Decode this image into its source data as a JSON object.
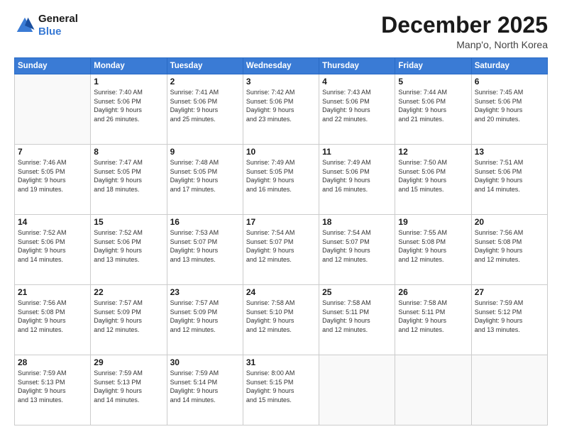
{
  "logo": {
    "line1": "General",
    "line2": "Blue"
  },
  "header": {
    "month": "December 2025",
    "location": "Manp'o, North Korea"
  },
  "weekdays": [
    "Sunday",
    "Monday",
    "Tuesday",
    "Wednesday",
    "Thursday",
    "Friday",
    "Saturday"
  ],
  "weeks": [
    [
      {
        "day": "",
        "info": ""
      },
      {
        "day": "1",
        "info": "Sunrise: 7:40 AM\nSunset: 5:06 PM\nDaylight: 9 hours\nand 26 minutes."
      },
      {
        "day": "2",
        "info": "Sunrise: 7:41 AM\nSunset: 5:06 PM\nDaylight: 9 hours\nand 25 minutes."
      },
      {
        "day": "3",
        "info": "Sunrise: 7:42 AM\nSunset: 5:06 PM\nDaylight: 9 hours\nand 23 minutes."
      },
      {
        "day": "4",
        "info": "Sunrise: 7:43 AM\nSunset: 5:06 PM\nDaylight: 9 hours\nand 22 minutes."
      },
      {
        "day": "5",
        "info": "Sunrise: 7:44 AM\nSunset: 5:06 PM\nDaylight: 9 hours\nand 21 minutes."
      },
      {
        "day": "6",
        "info": "Sunrise: 7:45 AM\nSunset: 5:06 PM\nDaylight: 9 hours\nand 20 minutes."
      }
    ],
    [
      {
        "day": "7",
        "info": "Sunrise: 7:46 AM\nSunset: 5:05 PM\nDaylight: 9 hours\nand 19 minutes."
      },
      {
        "day": "8",
        "info": "Sunrise: 7:47 AM\nSunset: 5:05 PM\nDaylight: 9 hours\nand 18 minutes."
      },
      {
        "day": "9",
        "info": "Sunrise: 7:48 AM\nSunset: 5:05 PM\nDaylight: 9 hours\nand 17 minutes."
      },
      {
        "day": "10",
        "info": "Sunrise: 7:49 AM\nSunset: 5:05 PM\nDaylight: 9 hours\nand 16 minutes."
      },
      {
        "day": "11",
        "info": "Sunrise: 7:49 AM\nSunset: 5:06 PM\nDaylight: 9 hours\nand 16 minutes."
      },
      {
        "day": "12",
        "info": "Sunrise: 7:50 AM\nSunset: 5:06 PM\nDaylight: 9 hours\nand 15 minutes."
      },
      {
        "day": "13",
        "info": "Sunrise: 7:51 AM\nSunset: 5:06 PM\nDaylight: 9 hours\nand 14 minutes."
      }
    ],
    [
      {
        "day": "14",
        "info": "Sunrise: 7:52 AM\nSunset: 5:06 PM\nDaylight: 9 hours\nand 14 minutes."
      },
      {
        "day": "15",
        "info": "Sunrise: 7:52 AM\nSunset: 5:06 PM\nDaylight: 9 hours\nand 13 minutes."
      },
      {
        "day": "16",
        "info": "Sunrise: 7:53 AM\nSunset: 5:07 PM\nDaylight: 9 hours\nand 13 minutes."
      },
      {
        "day": "17",
        "info": "Sunrise: 7:54 AM\nSunset: 5:07 PM\nDaylight: 9 hours\nand 12 minutes."
      },
      {
        "day": "18",
        "info": "Sunrise: 7:54 AM\nSunset: 5:07 PM\nDaylight: 9 hours\nand 12 minutes."
      },
      {
        "day": "19",
        "info": "Sunrise: 7:55 AM\nSunset: 5:08 PM\nDaylight: 9 hours\nand 12 minutes."
      },
      {
        "day": "20",
        "info": "Sunrise: 7:56 AM\nSunset: 5:08 PM\nDaylight: 9 hours\nand 12 minutes."
      }
    ],
    [
      {
        "day": "21",
        "info": "Sunrise: 7:56 AM\nSunset: 5:08 PM\nDaylight: 9 hours\nand 12 minutes."
      },
      {
        "day": "22",
        "info": "Sunrise: 7:57 AM\nSunset: 5:09 PM\nDaylight: 9 hours\nand 12 minutes."
      },
      {
        "day": "23",
        "info": "Sunrise: 7:57 AM\nSunset: 5:09 PM\nDaylight: 9 hours\nand 12 minutes."
      },
      {
        "day": "24",
        "info": "Sunrise: 7:58 AM\nSunset: 5:10 PM\nDaylight: 9 hours\nand 12 minutes."
      },
      {
        "day": "25",
        "info": "Sunrise: 7:58 AM\nSunset: 5:11 PM\nDaylight: 9 hours\nand 12 minutes."
      },
      {
        "day": "26",
        "info": "Sunrise: 7:58 AM\nSunset: 5:11 PM\nDaylight: 9 hours\nand 12 minutes."
      },
      {
        "day": "27",
        "info": "Sunrise: 7:59 AM\nSunset: 5:12 PM\nDaylight: 9 hours\nand 13 minutes."
      }
    ],
    [
      {
        "day": "28",
        "info": "Sunrise: 7:59 AM\nSunset: 5:13 PM\nDaylight: 9 hours\nand 13 minutes."
      },
      {
        "day": "29",
        "info": "Sunrise: 7:59 AM\nSunset: 5:13 PM\nDaylight: 9 hours\nand 14 minutes."
      },
      {
        "day": "30",
        "info": "Sunrise: 7:59 AM\nSunset: 5:14 PM\nDaylight: 9 hours\nand 14 minutes."
      },
      {
        "day": "31",
        "info": "Sunrise: 8:00 AM\nSunset: 5:15 PM\nDaylight: 9 hours\nand 15 minutes."
      },
      {
        "day": "",
        "info": ""
      },
      {
        "day": "",
        "info": ""
      },
      {
        "day": "",
        "info": ""
      }
    ]
  ]
}
